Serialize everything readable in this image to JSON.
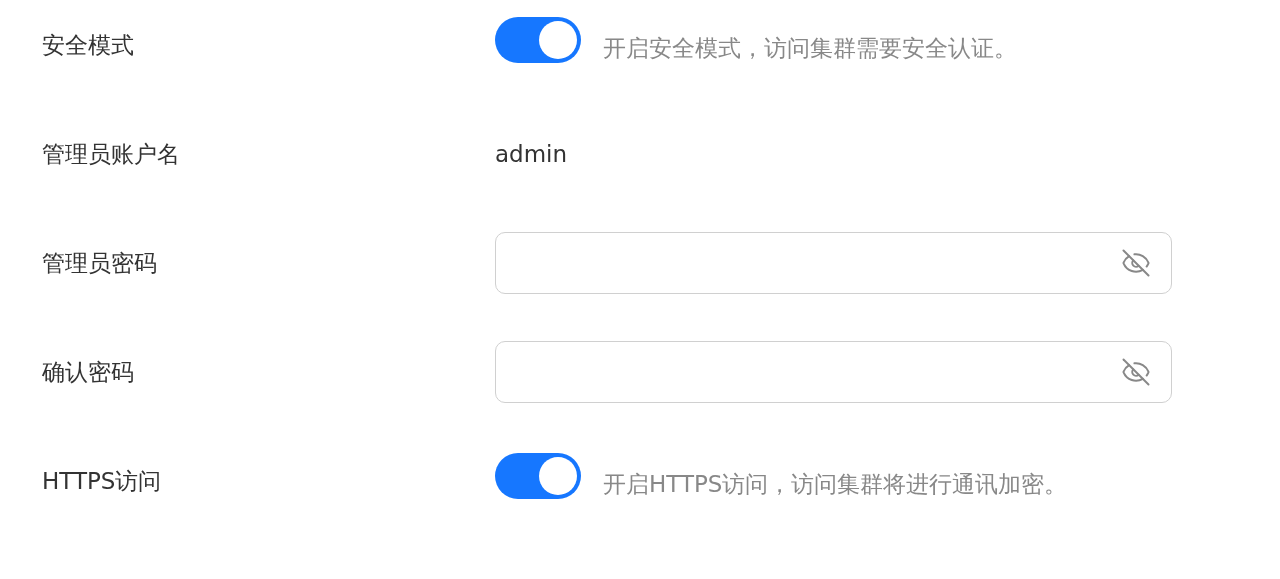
{
  "form": {
    "rows": [
      {
        "kind": "toggle",
        "label": "安全模式",
        "on": true,
        "description": "开启安全模式，访问集群需要安全认证。"
      },
      {
        "kind": "text",
        "label": "管理员账户名",
        "value": "admin"
      },
      {
        "kind": "password",
        "label": "管理员密码"
      },
      {
        "kind": "password",
        "label": "确认密码"
      },
      {
        "kind": "toggle",
        "label": "HTTPS访问",
        "on": true,
        "description": "开启HTTPS访问，访问集群将进行通讯加密。"
      }
    ]
  }
}
